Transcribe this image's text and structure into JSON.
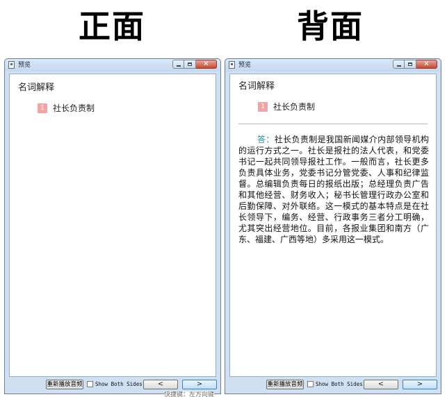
{
  "headings": {
    "front": "正面",
    "back": "背面"
  },
  "front_window": {
    "title": "预览",
    "section_label": "名词解释",
    "term_number": "1",
    "term_text": "社长负责制",
    "replay_button": "重新播放音频",
    "show_both_label": "Show Both Sides",
    "prev_label": "<",
    "next_label": ">"
  },
  "back_window": {
    "title": "预览",
    "section_label": "名词解释",
    "term_number": "1",
    "term_text": "社长负责制",
    "answer_label": "答：",
    "answer_text": "社长负责制是我国新闻媒介内部领导机构的运行方式之一。社长是报社的法人代表，和党委书记一起共同领导报社工作。一般而言，社长更多负责具体业务，党委书记分管党委、人事和纪律监督。总编辑负责每日的报纸出版；总经理负责广告和其他经营、财务收入；秘书长管理行政办公室和后勤保障、对外联络。这一模式的基本特点是在社长领导下，编务、经营、行政事务三者分工明确，尤其突出经营地位。目前，各报业集团和南方（广东、福建、广西等地）多采用这一模式。",
    "replay_button": "重新播放音频",
    "show_both_label": "Show Both Sides",
    "prev_label": "<",
    "next_label": ">"
  },
  "tooltip_text": "快捷键：左方向键"
}
